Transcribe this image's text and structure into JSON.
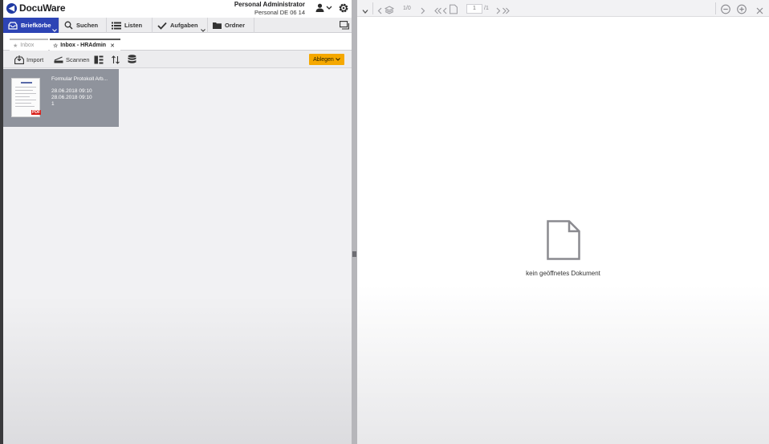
{
  "brand": {
    "name": "DocuWare",
    "logo_glyph": "◀"
  },
  "user": {
    "name": "Personal Administrator",
    "org": "Personal DE 06 14",
    "icon": "user-icon",
    "settings_icon": "gear-icon"
  },
  "nav": {
    "tabs": [
      {
        "label": "Briefkörbe",
        "icon": "inbox-icon",
        "active": true
      },
      {
        "label": "Suchen",
        "icon": "search-icon"
      },
      {
        "label": "Listen",
        "icon": "list-icon"
      },
      {
        "label": "Aufgaben",
        "icon": "check-icon"
      },
      {
        "label": "Ordner",
        "icon": "folder-icon"
      }
    ]
  },
  "doc_tabs": [
    {
      "label": "Inbox",
      "state": "inactive"
    },
    {
      "label": "Inbox - HRAdmin",
      "state": "active",
      "close": "✕"
    }
  ],
  "toolbar": {
    "import_label": "Import",
    "scan_label": "Scannen",
    "file_label": "Ablegen"
  },
  "document": {
    "title": "Formular Protokoll Arb...",
    "date1": "28.06.2018 09:10",
    "date2": "28.06.2018 09:10",
    "count": "1",
    "badge": "PDF"
  },
  "viewer": {
    "page_count": "1/0",
    "page_value": "1",
    "page_total": "/1",
    "empty_text": "kein geöffnetes Dokument"
  },
  "colors": {
    "accent": "#2d44b5",
    "ablegen": "#f5a800",
    "card": "#8f939c",
    "pdf": "#d9221c"
  }
}
